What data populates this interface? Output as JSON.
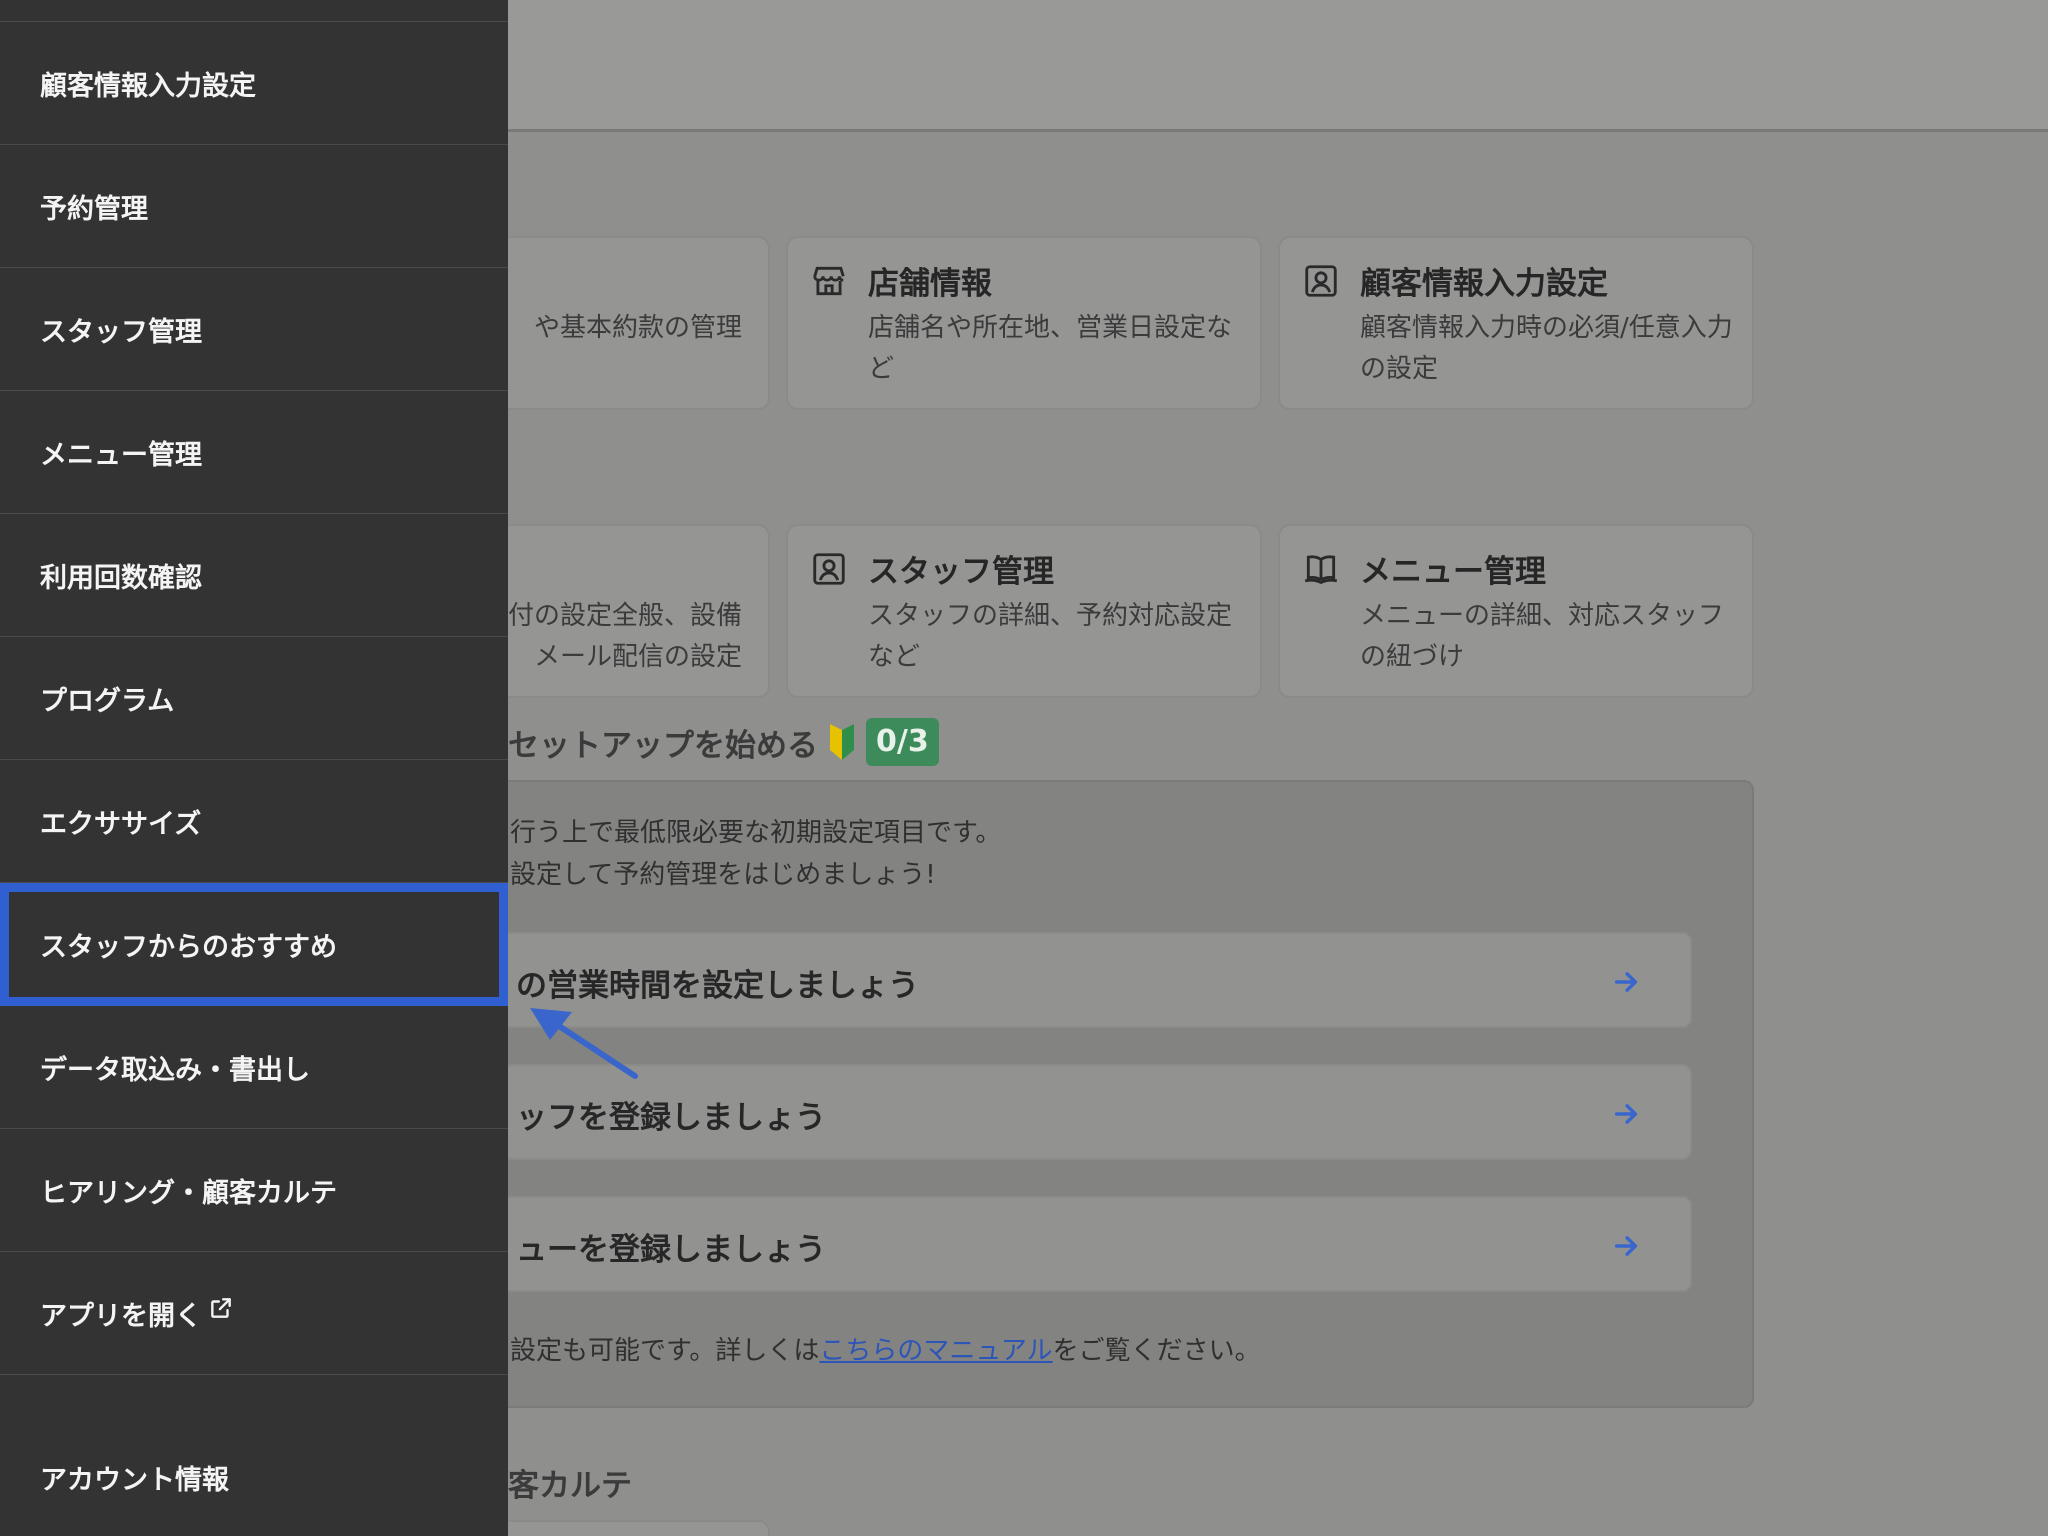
{
  "colors": {
    "sidebar_bg": "#333333",
    "highlight": "#2f5fd0",
    "badge_green": "#3d8a5a",
    "link_blue": "#2c55b8",
    "arrow_blue": "#3a66cc"
  },
  "sidebar": {
    "items": [
      {
        "label": "顧客情報入力設定"
      },
      {
        "label": "予約管理"
      },
      {
        "label": "スタッフ管理"
      },
      {
        "label": "メニュー管理"
      },
      {
        "label": "利用回数確認"
      },
      {
        "label": "プログラム"
      },
      {
        "label": "エクササイズ"
      },
      {
        "label": "スタッフからのおすすめ",
        "highlighted": true
      },
      {
        "label": "データ取込み・書出し"
      },
      {
        "label": "ヒアリング・顧客カルテ"
      },
      {
        "label": "アプリを開く",
        "icon": "external-link-icon"
      }
    ],
    "account_label": "アカウント情報"
  },
  "cards": [
    {
      "title": "",
      "desc": "や基本約款の管理",
      "icon": ""
    },
    {
      "title": "店舗情報",
      "desc": "店舗名や所在地、営業日設定など",
      "icon": "store-icon"
    },
    {
      "title": "顧客情報入力設定",
      "desc": "顧客情報入力時の必須/任意入力の設定",
      "icon": "person-icon"
    },
    {
      "title": "",
      "desc1": "付の設定全般、設備",
      "desc2": "メール配信の設定",
      "icon": ""
    },
    {
      "title": "スタッフ管理",
      "desc": "スタッフの詳細、予約対応設定など",
      "icon": "person-icon"
    },
    {
      "title": "メニュー管理",
      "desc": "メニューの詳細、対応スタッフの紐づけ",
      "icon": "book-icon"
    }
  ],
  "setup": {
    "title": "セットアップを始める",
    "badge": "0/3",
    "intro_line1": "行う上で最低限必要な初期設定項目です。",
    "intro_line2": "設定して予約管理をはじめましょう!",
    "tasks": [
      {
        "label": "の営業時間を設定しましょう"
      },
      {
        "label": "ッフを登録しましょう"
      },
      {
        "label": "ューを登録しましょう"
      }
    ],
    "footer_prefix": "設定も可能です。詳しくは",
    "footer_link": "こちらのマニュアル",
    "footer_suffix": "をご覧ください。"
  },
  "section_karte": "客カルテ"
}
